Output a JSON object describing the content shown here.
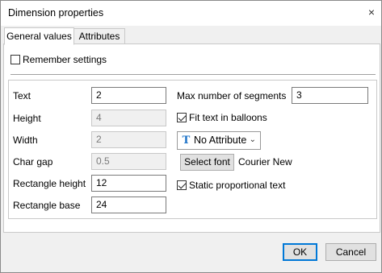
{
  "window": {
    "title": "Dimension properties",
    "close_glyph": "×"
  },
  "tabs": [
    {
      "label": "General values",
      "active": true
    },
    {
      "label": "Attributes",
      "active": false
    }
  ],
  "remember": {
    "label": "Remember settings",
    "checked": false
  },
  "left_fields": [
    {
      "label": "Text",
      "value": "2",
      "disabled": false
    },
    {
      "label": "Height",
      "value": "4",
      "disabled": true
    },
    {
      "label": "Width",
      "value": "2",
      "disabled": true
    },
    {
      "label": "Char gap",
      "value": "0.5",
      "disabled": true
    },
    {
      "label": "Rectangle height",
      "value": "12",
      "disabled": false
    },
    {
      "label": "Rectangle base",
      "value": "24",
      "disabled": false
    }
  ],
  "segments": {
    "label": "Max number of segments",
    "value": "3"
  },
  "fit_text": {
    "label": "Fit text in balloons",
    "checked": true
  },
  "attribute_dropdown": {
    "icon": "T",
    "value": "No Attribute"
  },
  "font": {
    "button_label": "Select font",
    "current": "Courier New"
  },
  "static_prop": {
    "label": "Static proportional text",
    "checked": true
  },
  "buttons": {
    "ok": "OK",
    "cancel": "Cancel"
  }
}
